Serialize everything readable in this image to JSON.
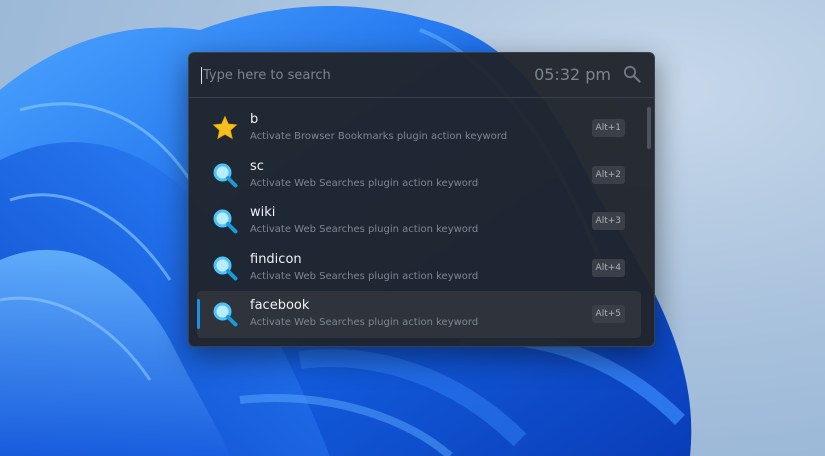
{
  "search": {
    "placeholder": "Type here to search",
    "value": ""
  },
  "clock": {
    "time": "05:32 pm"
  },
  "results": [
    {
      "title": "b",
      "subtitle": "Activate Browser Bookmarks plugin action keyword",
      "hotkey": "Alt+1",
      "icon": "star-icon"
    },
    {
      "title": "sc",
      "subtitle": "Activate Web Searches plugin action keyword",
      "hotkey": "Alt+2",
      "icon": "web-search-icon"
    },
    {
      "title": "wiki",
      "subtitle": "Activate Web Searches plugin action keyword",
      "hotkey": "Alt+3",
      "icon": "web-search-icon"
    },
    {
      "title": "findicon",
      "subtitle": "Activate Web Searches plugin action keyword",
      "hotkey": "Alt+4",
      "icon": "web-search-icon"
    },
    {
      "title": "facebook",
      "subtitle": "Activate Web Searches plugin action keyword",
      "hotkey": "Alt+5",
      "icon": "web-search-icon",
      "selected": true
    }
  ],
  "colors": {
    "accent": "#1e8ee6",
    "star": "#f5c01d",
    "search_icon": "#4fc3f7",
    "panel": "#20242c"
  }
}
